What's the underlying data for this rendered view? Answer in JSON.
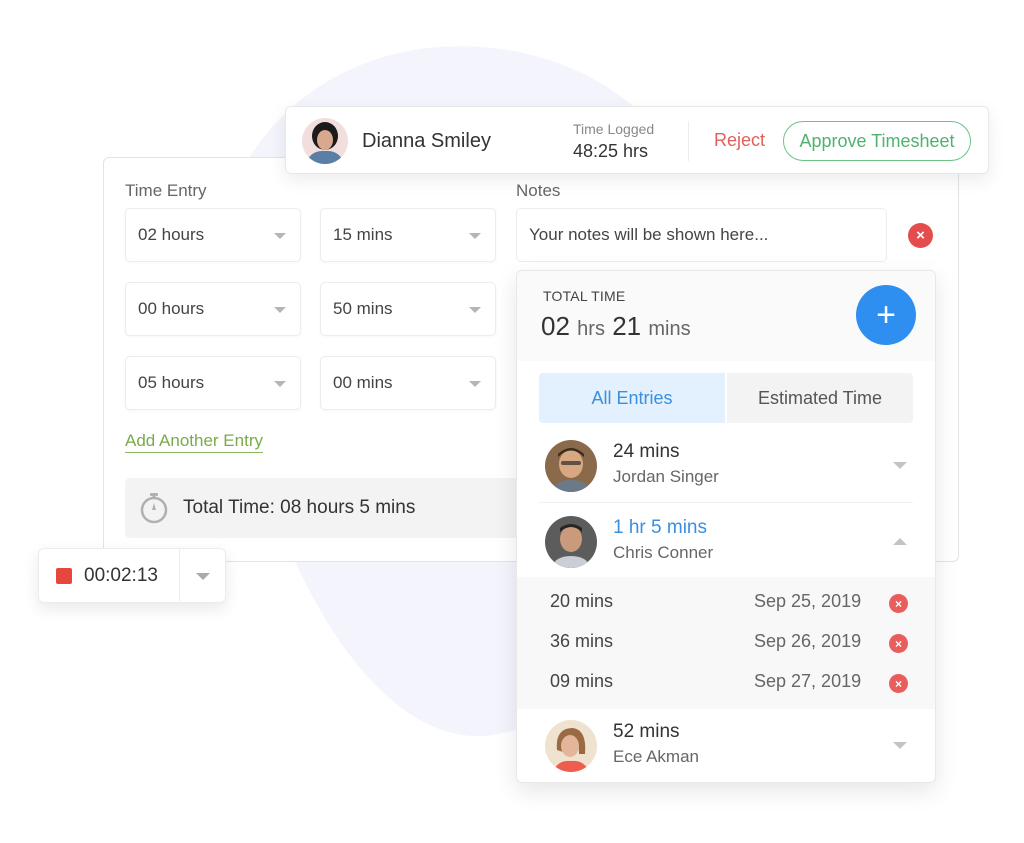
{
  "header": {
    "user_name": "Dianna Smiley",
    "time_logged_label": "Time Logged",
    "time_logged_value": "48:25 hrs",
    "reject_label": "Reject",
    "approve_label": "Approve Timesheet"
  },
  "time_entry": {
    "label": "Time Entry",
    "rows": [
      {
        "hours": "02 hours",
        "mins": "15 mins"
      },
      {
        "hours": "00 hours",
        "mins": "50 mins"
      },
      {
        "hours": "05 hours",
        "mins": "00 mins"
      }
    ],
    "add_entry_label": "Add Another Entry",
    "total_label": "Total Time: 08 hours 5 mins"
  },
  "notes": {
    "label": "Notes",
    "placeholder": "Your notes will be shown here..."
  },
  "timer": {
    "elapsed": "00:02:13"
  },
  "popup": {
    "total_time_label": "TOTAL TIME",
    "total_hours": "02",
    "hours_unit": "hrs",
    "total_minutes": "21",
    "minutes_unit": "mins",
    "add_icon": "+",
    "tabs": [
      {
        "label": "All Entries",
        "active": true
      },
      {
        "label": "Estimated Time",
        "active": false
      }
    ],
    "people": [
      {
        "duration": "24 mins",
        "name": "Jordan Singer",
        "expanded": false
      },
      {
        "duration": "1 hr 5 mins",
        "name": "Chris Conner",
        "expanded": true,
        "entries": [
          {
            "duration": "20 mins",
            "date": "Sep 25, 2019"
          },
          {
            "duration": "36 mins",
            "date": "Sep 26, 2019"
          },
          {
            "duration": "09 mins",
            "date": "Sep 27, 2019"
          }
        ]
      },
      {
        "duration": "52 mins",
        "name": "Ece Akman",
        "expanded": false
      }
    ]
  },
  "icons": {
    "remove": "×",
    "stopwatch": "stopwatch-icon",
    "dropdown": "caret-down-icon"
  },
  "colors": {
    "accent_blue": "#2f8ff0",
    "approve_green": "#4fb36e",
    "reject_red": "#e0605c",
    "link_green": "#7aab4a",
    "stop_red": "#e5473d"
  }
}
